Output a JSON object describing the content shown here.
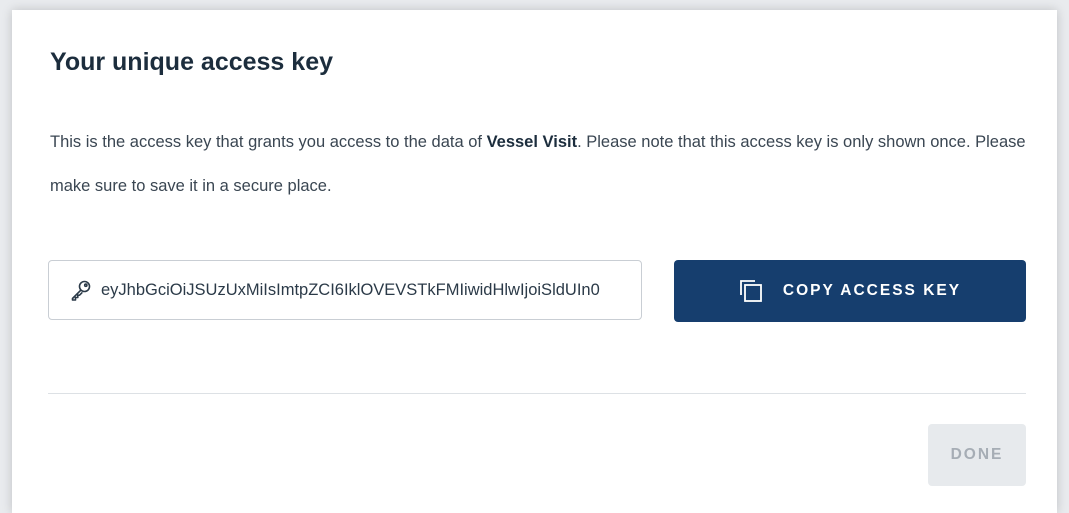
{
  "dialog": {
    "title": "Your unique access key",
    "description": {
      "before": "This is the access key that grants you access to the data of ",
      "emphasis": "Vessel Visit",
      "after": ". Please note that this access key is only shown once. Please make sure to save it in a secure place."
    },
    "key_field": {
      "icon": "key-icon",
      "value": "eyJhbGciOiJSUzUxMiIsImtpZCI6IklOVEVSTkFMIiwidHlwIjoiSldUIn0"
    },
    "copy_button": {
      "icon": "copy-icon",
      "label": "COPY ACCESS KEY"
    },
    "done_button": {
      "label": "DONE",
      "disabled": true
    }
  },
  "colors": {
    "primary": "#163e6e",
    "title_text": "#1c2d3d",
    "body_text": "#3a4652",
    "disabled_bg": "#e7eaed",
    "disabled_text": "#a6adb5"
  }
}
